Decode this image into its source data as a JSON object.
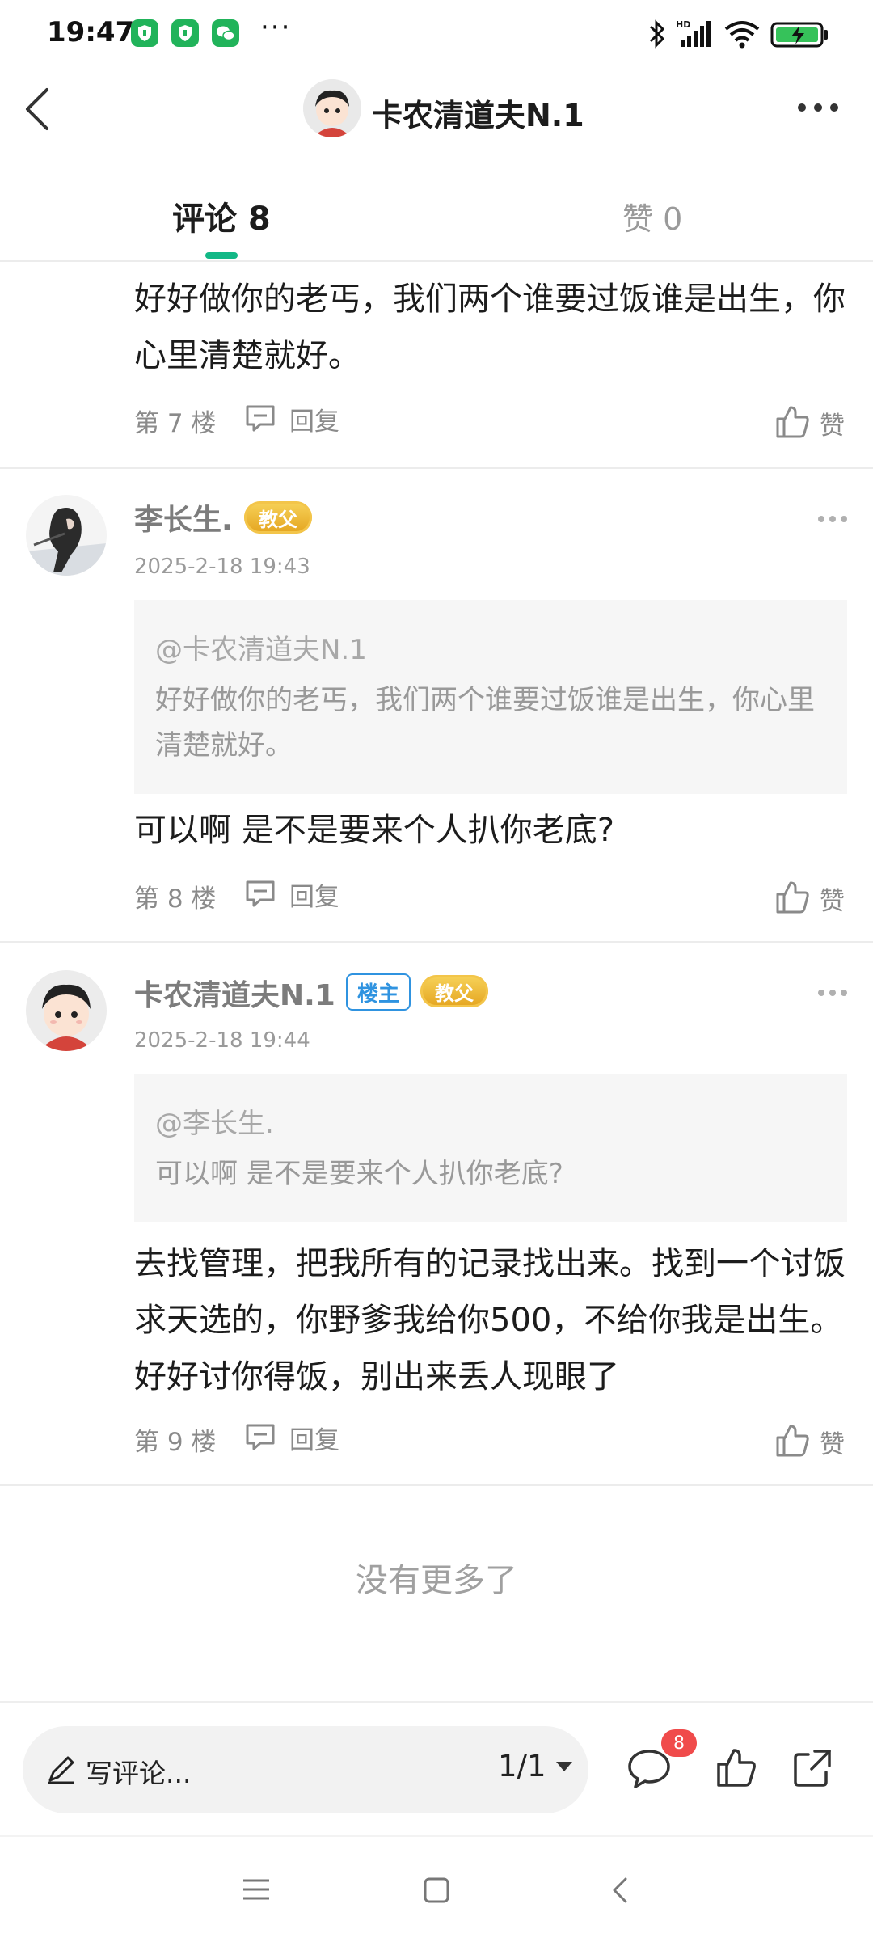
{
  "status_bar": {
    "time": "19:47",
    "more_glyph": "···",
    "icons": [
      "app-shield-icon",
      "app-shield-icon",
      "wechat-icon",
      "bluetooth-icon",
      "hd-signal-icon",
      "wifi-icon",
      "battery-charging-icon"
    ]
  },
  "header": {
    "title": "卡农清道夫N.1",
    "back_icon": "back-arrow-icon",
    "more_icon": "more-horizontal-icon"
  },
  "tabs": [
    {
      "label": "评论 8",
      "active": true
    },
    {
      "label": "赞 0",
      "active": false
    }
  ],
  "accent_color": "#12b886",
  "comments": [
    {
      "floor_label": "第 7 楼",
      "body": "好好做你的老丐，我们两个谁要过饭谁是出生，你心里清楚就好。",
      "reply_label": "回复",
      "like_label": "赞"
    },
    {
      "username": "李长生.",
      "badges": [
        "教父"
      ],
      "timestamp": "2025-2-18 19:43",
      "quote": {
        "mention": "@卡农清道夫N.1",
        "text": "好好做你的老丐，我们两个谁要过饭谁是出生，你心里清楚就好。"
      },
      "body": "可以啊 是不是要来个人扒你老底?",
      "floor_label": "第 8 楼",
      "reply_label": "回复",
      "like_label": "赞"
    },
    {
      "username": "卡农清道夫N.1",
      "owner_badge": "楼主",
      "badges": [
        "教父"
      ],
      "timestamp": "2025-2-18 19:44",
      "quote": {
        "mention": "@李长生.",
        "text": "可以啊 是不是要来个人扒你老底?"
      },
      "body": "去找管理，把我所有的记录找出来。找到一个讨饭求天选的，你野爹我给你500，不给你我是出生。好好讨你得饭，别出来丢人现眼了",
      "floor_label": "第 9 楼",
      "reply_label": "回复",
      "like_label": "赞"
    }
  ],
  "end_text": "没有更多了",
  "bottom_bar": {
    "compose_placeholder": "写评论...",
    "page_indicator": "1/1",
    "comment_count_badge": "8"
  }
}
